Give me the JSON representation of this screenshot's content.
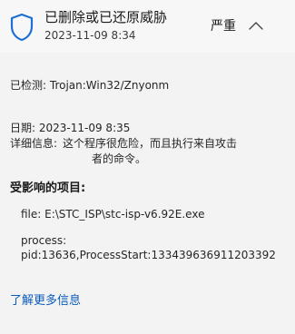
{
  "header": {
    "title": "已删除或已还原威胁",
    "timestamp": "2023-11-09 8:34",
    "severity": "严重",
    "shield_icon": "shield-icon",
    "chevron_icon": "chevron-up-icon"
  },
  "details": {
    "detected_label": "已检测:",
    "detected_value": "Trojan:Win32/Znyonm",
    "date_label": "日期:",
    "date_value": "2023-11-09 8:35",
    "detail_label": "详细信息:",
    "detail_line1": "这个程序很危险，而且执行来自攻击",
    "detail_line2": "者的命令。"
  },
  "affected": {
    "heading": "受影响的项目:",
    "file": "file: E:\\STC_ISP\\stc-isp-v6.92E.exe",
    "process_label": "process:",
    "process_value": "pid:13636,ProcessStart:133439636911203392"
  },
  "links": {
    "learn_more": "了解更多信息"
  },
  "colors": {
    "accent": "#0a5bbd",
    "background": "#f3f3f3",
    "header_bg": "#f7f7f7"
  }
}
